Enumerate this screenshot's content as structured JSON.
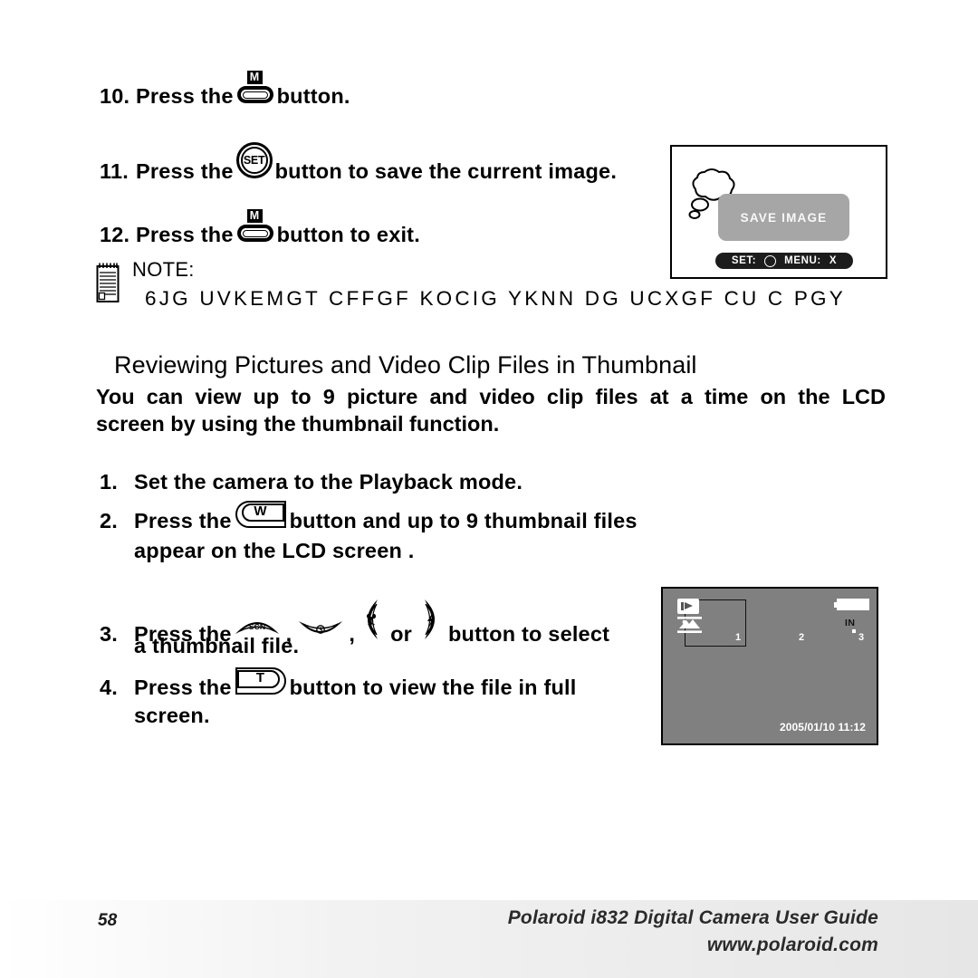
{
  "document": {
    "page_number": "58",
    "footer_title": "Polaroid i832 Digital Camera User Guide",
    "footer_url": "www.polaroid.com"
  },
  "steps_top": [
    {
      "number": "10.",
      "text_before": "Press the",
      "button": "mode-button",
      "button_label": "M",
      "text_after": "button."
    },
    {
      "number": "11.",
      "text_before": "Press the",
      "button": "set-button",
      "button_label": "SET",
      "text_after": "button to save the current image."
    },
    {
      "number": "12.",
      "text_before": "Press the",
      "button": "mode-button",
      "button_label": "M",
      "text_after": "button to exit."
    }
  ],
  "note": {
    "label": "NOTE:",
    "text": "6JG  UVKEMGT  CFFGF  KOCIG  YKNN  DG  UCXGF  CU  C  PGY"
  },
  "section": {
    "heading": "Reviewing Pictures and Video Clip Files in Thumbnail",
    "intro_line1": "You can view up to 9 picture and video clip files at a time on the LCD",
    "intro_line2": "screen by using the thumbnail function."
  },
  "steps_bottom": [
    {
      "number": "1.",
      "line1": "Set the camera to the Playback mode."
    },
    {
      "number": "2.",
      "text_before": "Press the",
      "button_label": "W",
      "text_after": "button and up to 9 thumbnail files",
      "line2": "appear on the LCD screen ."
    },
    {
      "number": "3.",
      "text_before": "Press the",
      "buttons": [
        "SCN",
        "self-timer",
        "macro",
        "flash"
      ],
      "separator1": ",",
      "separator2": ",",
      "separator3": "or",
      "text_after": "button to select",
      "line2": "a thumbnail file."
    },
    {
      "number": "4.",
      "text_before": "Press the",
      "button_label": "T",
      "text_after": "button to view the file in full",
      "line2": "screen."
    }
  ],
  "lcd_save": {
    "dialog_text": "SAVE IMAGE",
    "set_label": "SET:",
    "menu_label": "MENU:",
    "menu_value": "X"
  },
  "lcd_thumbnail": {
    "thumb_numbers": [
      "1",
      "2",
      "3"
    ],
    "memory_label": "IN",
    "date_stamp": "2005/01/10 11:12"
  },
  "colors": {
    "lcd_background": "#808080",
    "dialog_background": "#a6a6a6",
    "bar_background": "#1c1c1c",
    "text_white": "#ffffff"
  }
}
